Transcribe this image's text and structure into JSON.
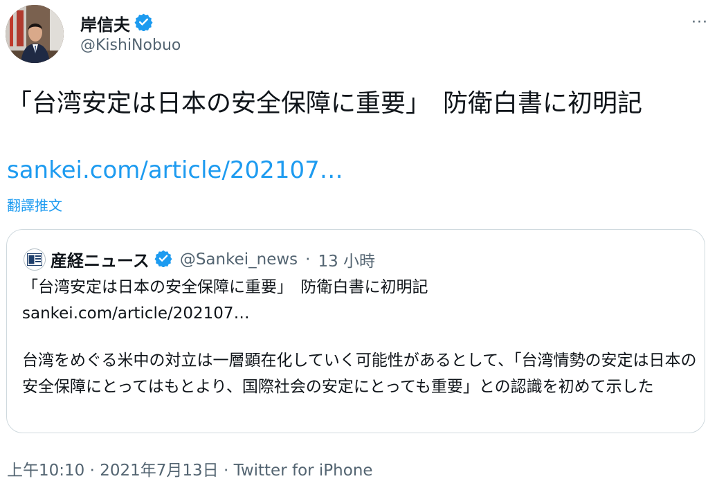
{
  "author": {
    "name": "岸信夫",
    "handle": "@KishiNobuo",
    "verified_icon": "verified-badge-icon"
  },
  "more_icon": "more-horizontal-icon",
  "more_label": "···",
  "tweet": {
    "text": "「台湾安定は日本の安全保障に重要」　防衛白書に初明記",
    "link": "sankei.com/article/202107…",
    "translate_label": "翻譯推文"
  },
  "quote": {
    "name": "産経ニュース",
    "handle": "@Sankei_news",
    "separator": "·",
    "time": "13 小時",
    "headline": "「台湾安定は日本の安全保障に重要」　防衛白書に初明記",
    "link": "sankei.com/article/202107…",
    "body": "台湾をめぐる米中の対立は一層顕在化していく可能性があるとして、「台湾情勢の安定は日本の安全保障にとってはもとより、国際社会の安定にとっても重要」との認識を初めて示した"
  },
  "footer": {
    "text": "上午10:10 · 2021年7月13日 · Twitter for iPhone"
  },
  "colors": {
    "link": "#1d9bf0",
    "secondary_text": "#536471",
    "border": "#cfd9de",
    "verified": "#1d9bf0"
  }
}
